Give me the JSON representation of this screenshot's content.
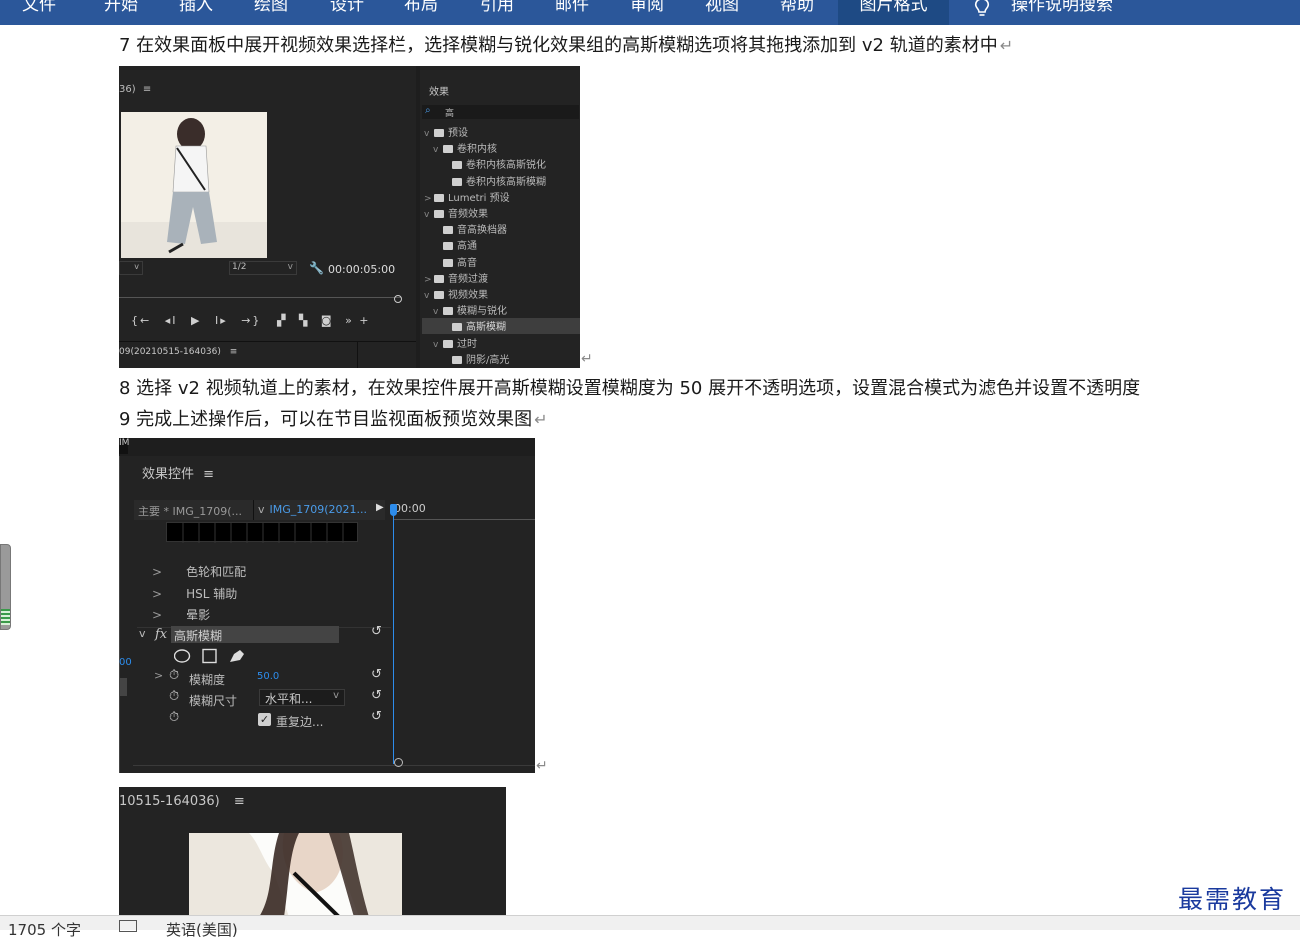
{
  "ribbon": {
    "tabs": [
      "文件",
      "开始",
      "插入",
      "绘图",
      "设计",
      "布局",
      "引用",
      "邮件",
      "审阅",
      "视图",
      "帮助",
      "图片格式"
    ],
    "active_tab": "图片格式",
    "tell_me": "操作说明搜索"
  },
  "doc": {
    "p7": "7 在效果面板中展开视频效果选择栏，选择模糊与锐化效果组的高斯模糊选项将其拖拽添加到 v2 轨道的素材中",
    "p8": "8 选择 v2 视频轨道上的素材，在效果控件展开高斯模糊设置模糊度为 50  展开不透明选项，设置混合模式为滤色并设置不透明度",
    "p9": "9 完成上述操作后，可以在节目监视面板预览效果图",
    "para_mark": "↵"
  },
  "shot1": {
    "monitor_title": "36)",
    "menu": "≡",
    "ratio": "1/2",
    "timecode": "00:00:05:00",
    "bottom_title": "09(20210515-164036)",
    "effects_title": "效果",
    "search_value": "高",
    "tree": [
      {
        "label": "预设",
        "level": 0,
        "chev": "v"
      },
      {
        "label": "卷积内核",
        "level": 1,
        "chev": "v"
      },
      {
        "label": "卷积内核高斯锐化",
        "level": 2,
        "chev": ""
      },
      {
        "label": "卷积内核高斯模糊",
        "level": 2,
        "chev": ""
      },
      {
        "label": "Lumetri 预设",
        "level": 0,
        "chev": ">"
      },
      {
        "label": "音频效果",
        "level": 0,
        "chev": "v"
      },
      {
        "label": "音高换档器",
        "level": 1,
        "chev": ""
      },
      {
        "label": "高通",
        "level": 1,
        "chev": ""
      },
      {
        "label": "高音",
        "level": 1,
        "chev": ""
      },
      {
        "label": "音频过渡",
        "level": 0,
        "chev": ">"
      },
      {
        "label": "视频效果",
        "level": 0,
        "chev": "v"
      },
      {
        "label": "模糊与锐化",
        "level": 1,
        "chev": "v"
      },
      {
        "label": "高斯模糊",
        "level": 2,
        "chev": "",
        "selected": true
      },
      {
        "label": "过时",
        "level": 1,
        "chev": "v"
      },
      {
        "label": "阴影/高光",
        "level": 2,
        "chev": ""
      }
    ]
  },
  "shot2": {
    "corner": "IM",
    "title": "效果控件",
    "menu": "≡",
    "master": "主要 * IMG_1709(...",
    "clip": "IMG_1709(2021...",
    "timecode": "00:00",
    "effects": [
      "色轮和匹配",
      "HSL 辅助",
      "晕影"
    ],
    "fx_label": "fx",
    "gaussian": "高斯模糊",
    "blur_label": "模糊度",
    "blur_value": "50.0",
    "dim_label": "模糊尺寸",
    "dim_value": "水平和...",
    "repeat_label": "重复边...",
    "side_num": "00"
  },
  "shot3": {
    "title": "10515-164036)",
    "menu": "≡"
  },
  "status": {
    "words": "1705 个字",
    "lang": "英语(美国)"
  },
  "watermark": "最需教育",
  "colors": {
    "ribbon": "#2b579a",
    "panel": "#232323",
    "accent_blue": "#2d8ceb",
    "watermark": "#1a3a9e"
  }
}
